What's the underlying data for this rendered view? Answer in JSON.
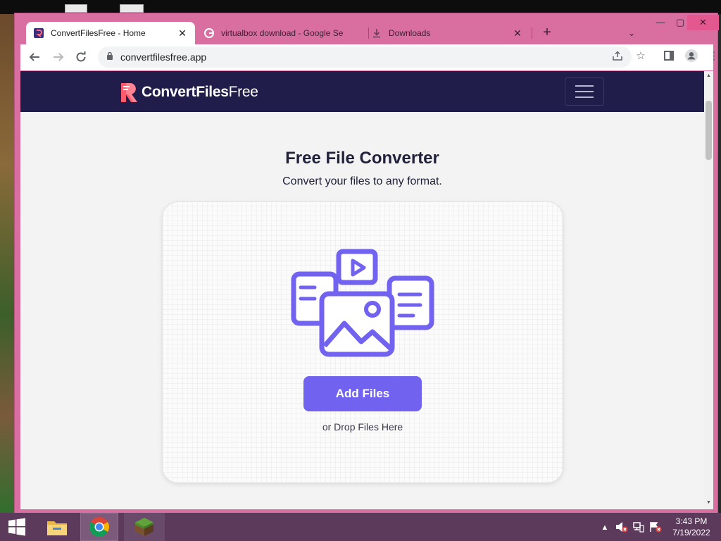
{
  "browser": {
    "tabs": [
      {
        "title": "ConvertFilesFree - Home",
        "active": true,
        "favicon": "convertfilesfree-favicon"
      },
      {
        "title": "virtualbox download - Google Se",
        "active": false,
        "favicon": "google-favicon"
      },
      {
        "title": "Downloads",
        "active": false,
        "favicon": "download-icon"
      }
    ],
    "url": "convertfilesfree.app"
  },
  "site": {
    "logo_bold": "ConvertFiles",
    "logo_light": "Free",
    "heading": "Free File Converter",
    "subheading": "Convert your files to any format.",
    "add_files_label": "Add Files",
    "drop_text": "or Drop Files Here",
    "accent": "#7162f0",
    "nav_bg": "#201d4a"
  },
  "taskbar": {
    "time": "3:43 PM",
    "date": "7/19/2022"
  }
}
